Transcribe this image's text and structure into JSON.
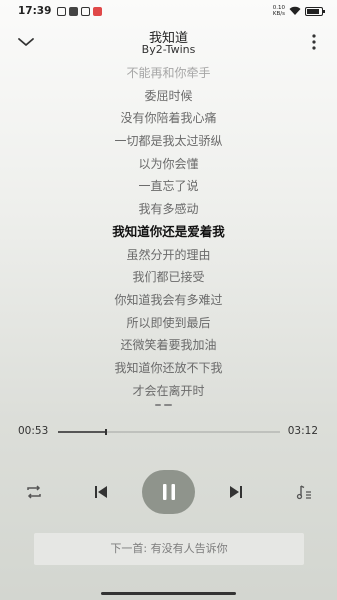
{
  "status_bar": {
    "time": "17:39",
    "net_speed": "0.10",
    "net_unit": "KB/s",
    "battery_level": 0.85
  },
  "header": {
    "title": "我知道",
    "artist": "By2-Twins"
  },
  "lyrics": [
    {
      "text": "不能再和你牵手",
      "state": "faded"
    },
    {
      "text": "委屈时候",
      "state": "normal"
    },
    {
      "text": "没有你陪着我心痛",
      "state": "normal"
    },
    {
      "text": "一切都是我太过骄纵",
      "state": "normal"
    },
    {
      "text": "以为你会懂",
      "state": "normal"
    },
    {
      "text": "一直忘了说",
      "state": "normal"
    },
    {
      "text": "我有多感动",
      "state": "normal"
    },
    {
      "text": "我知道你还是爱着我",
      "state": "current"
    },
    {
      "text": "虽然分开的理由",
      "state": "normal"
    },
    {
      "text": "我们都已接受",
      "state": "normal"
    },
    {
      "text": "你知道我会有多难过",
      "state": "normal"
    },
    {
      "text": "所以即使到最后",
      "state": "normal"
    },
    {
      "text": "还微笑着要我加油",
      "state": "normal"
    },
    {
      "text": "我知道你还放不下我",
      "state": "normal"
    },
    {
      "text": "才会在离开时",
      "state": "normal"
    }
  ],
  "playback": {
    "current_time": "00:53",
    "duration": "03:12",
    "progress": 0.217
  },
  "controls": {
    "repeat_icon": "repeat-icon",
    "prev_icon": "skip-previous-icon",
    "play_icon": "pause-icon",
    "next_icon": "skip-next-icon",
    "playlist_icon": "playlist-icon"
  },
  "next_up": {
    "label": "下一首: 有没有人告诉你"
  },
  "colors": {
    "play_button": "#8f948c",
    "accent_text": "#111111"
  }
}
